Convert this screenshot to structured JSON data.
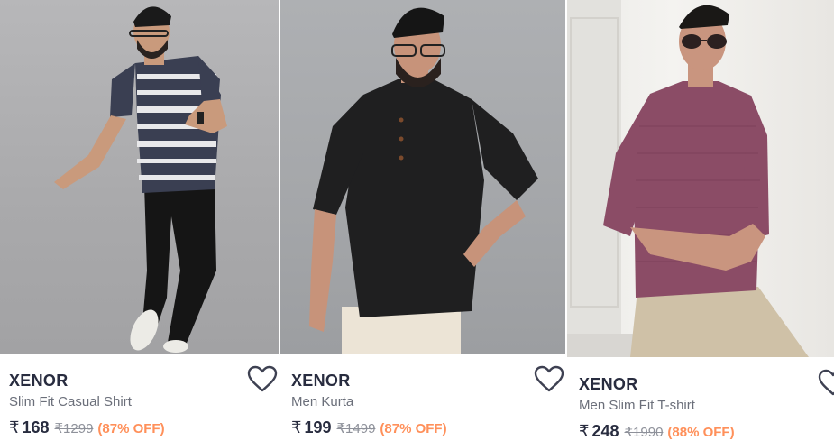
{
  "products": [
    {
      "brand": "XENOR",
      "title": "Slim Fit Casual Shirt",
      "currency": "₹",
      "price": "168",
      "mrp": "₹1299",
      "discount": "(87% OFF)",
      "wishlist_icon": "heart-outline-icon"
    },
    {
      "brand": "XENOR",
      "title": "Men Kurta",
      "currency": "₹",
      "price": "199",
      "mrp": "₹1499",
      "discount": "(87% OFF)",
      "wishlist_icon": "heart-outline-icon"
    },
    {
      "brand": "XENOR",
      "title": "Men Slim Fit T-shirt",
      "currency": "₹",
      "price": "248",
      "mrp": "₹1990",
      "discount": "(88% OFF)",
      "wishlist_icon": "heart-outline-icon"
    }
  ],
  "colors": {
    "brand_text": "#282c3f",
    "title_text": "#6b6f7a",
    "mrp_text": "#8e919a",
    "discount_text": "#ff905a"
  }
}
